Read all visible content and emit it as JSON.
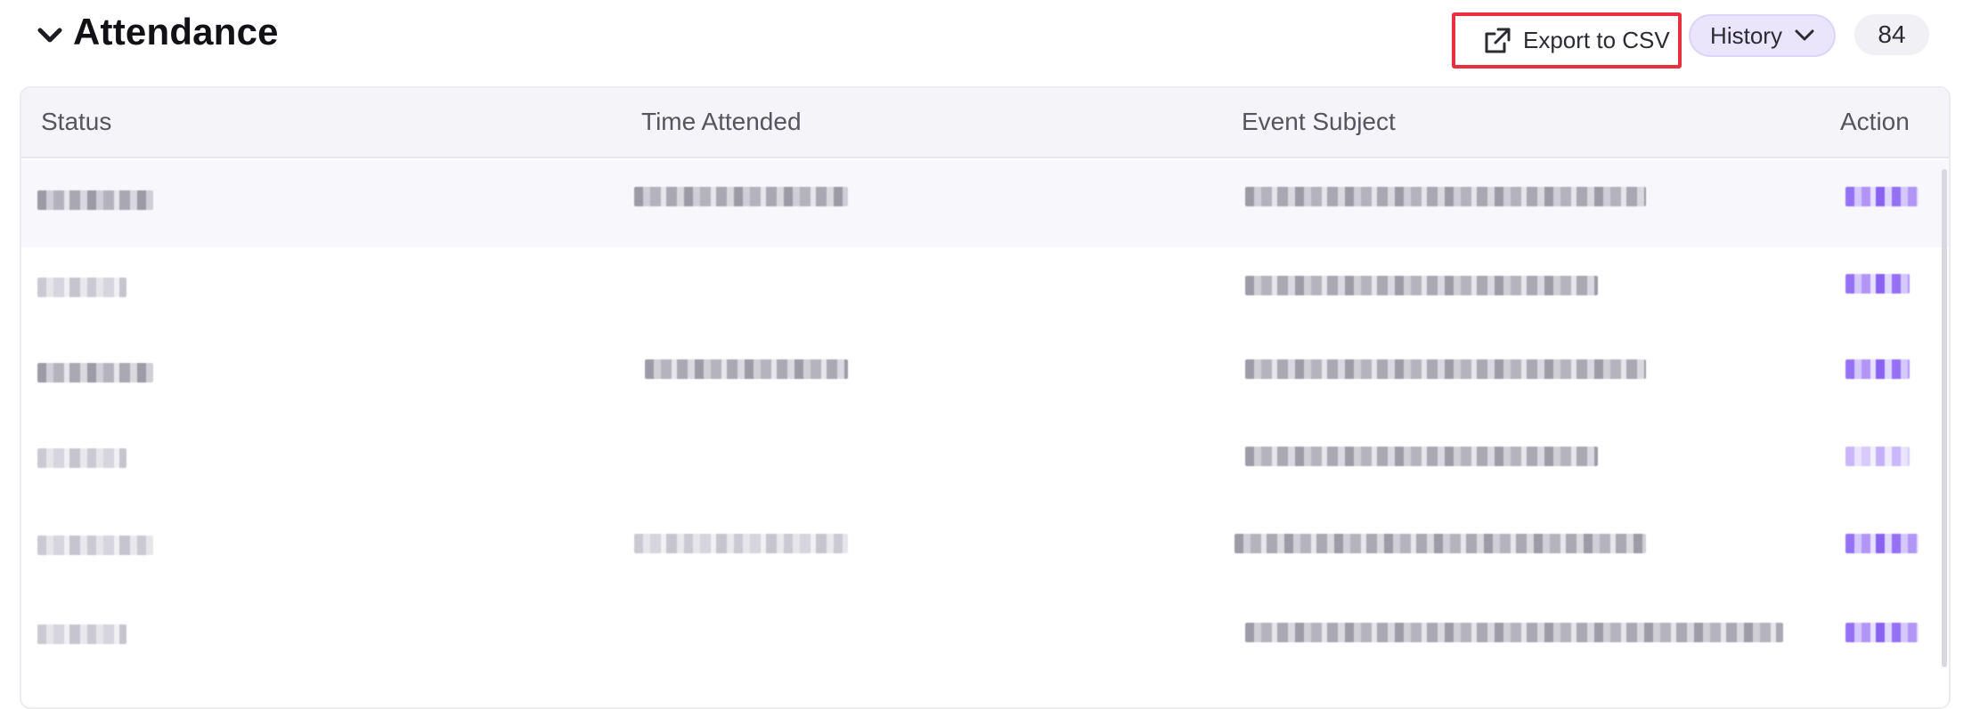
{
  "section": {
    "title": "Attendance",
    "export_label": "Export to CSV",
    "history_label": "History",
    "count": "84"
  },
  "table": {
    "columns": [
      "Status",
      "Time Attended",
      "Event Subject",
      "Action"
    ]
  },
  "icons": {
    "collapse": "chevron-down-icon",
    "export": "external-link-icon",
    "history": "chevron-down-icon"
  },
  "colors": {
    "accent": "#8a62f2",
    "highlight_border": "#e8303f",
    "history_bg": "#eae5fb"
  }
}
